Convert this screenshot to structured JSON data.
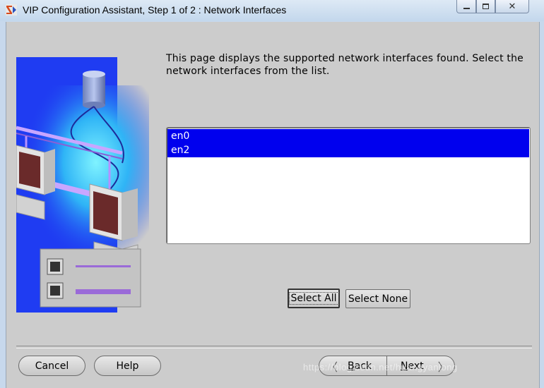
{
  "window": {
    "title": "VIP Configuration Assistant, Step 1 of 2 : Network Interfaces",
    "controls": {
      "minimize": "▭",
      "maximize": "▢",
      "close": "✕"
    }
  },
  "page": {
    "description": "This page displays the supported network interfaces found. Select the network interfaces from the list."
  },
  "interfaces": {
    "items": [
      {
        "label": "en0",
        "selected": true
      },
      {
        "label": "en2",
        "selected": true
      }
    ]
  },
  "selection_buttons": {
    "select_all": "Select All",
    "select_none": "Select None"
  },
  "footer": {
    "cancel": "Cancel",
    "help": "Help",
    "back_prefix": "",
    "back_mnemonic": "B",
    "back_rest": "ack",
    "next_mnemonic": "N",
    "next_rest": "ext"
  },
  "watermark": "https://blog.csdn.net/huangyanlong",
  "colors": {
    "selection": "#0000ee",
    "illustration_blue": "#1f3cf2",
    "dialog_bg": "#cccccc"
  }
}
